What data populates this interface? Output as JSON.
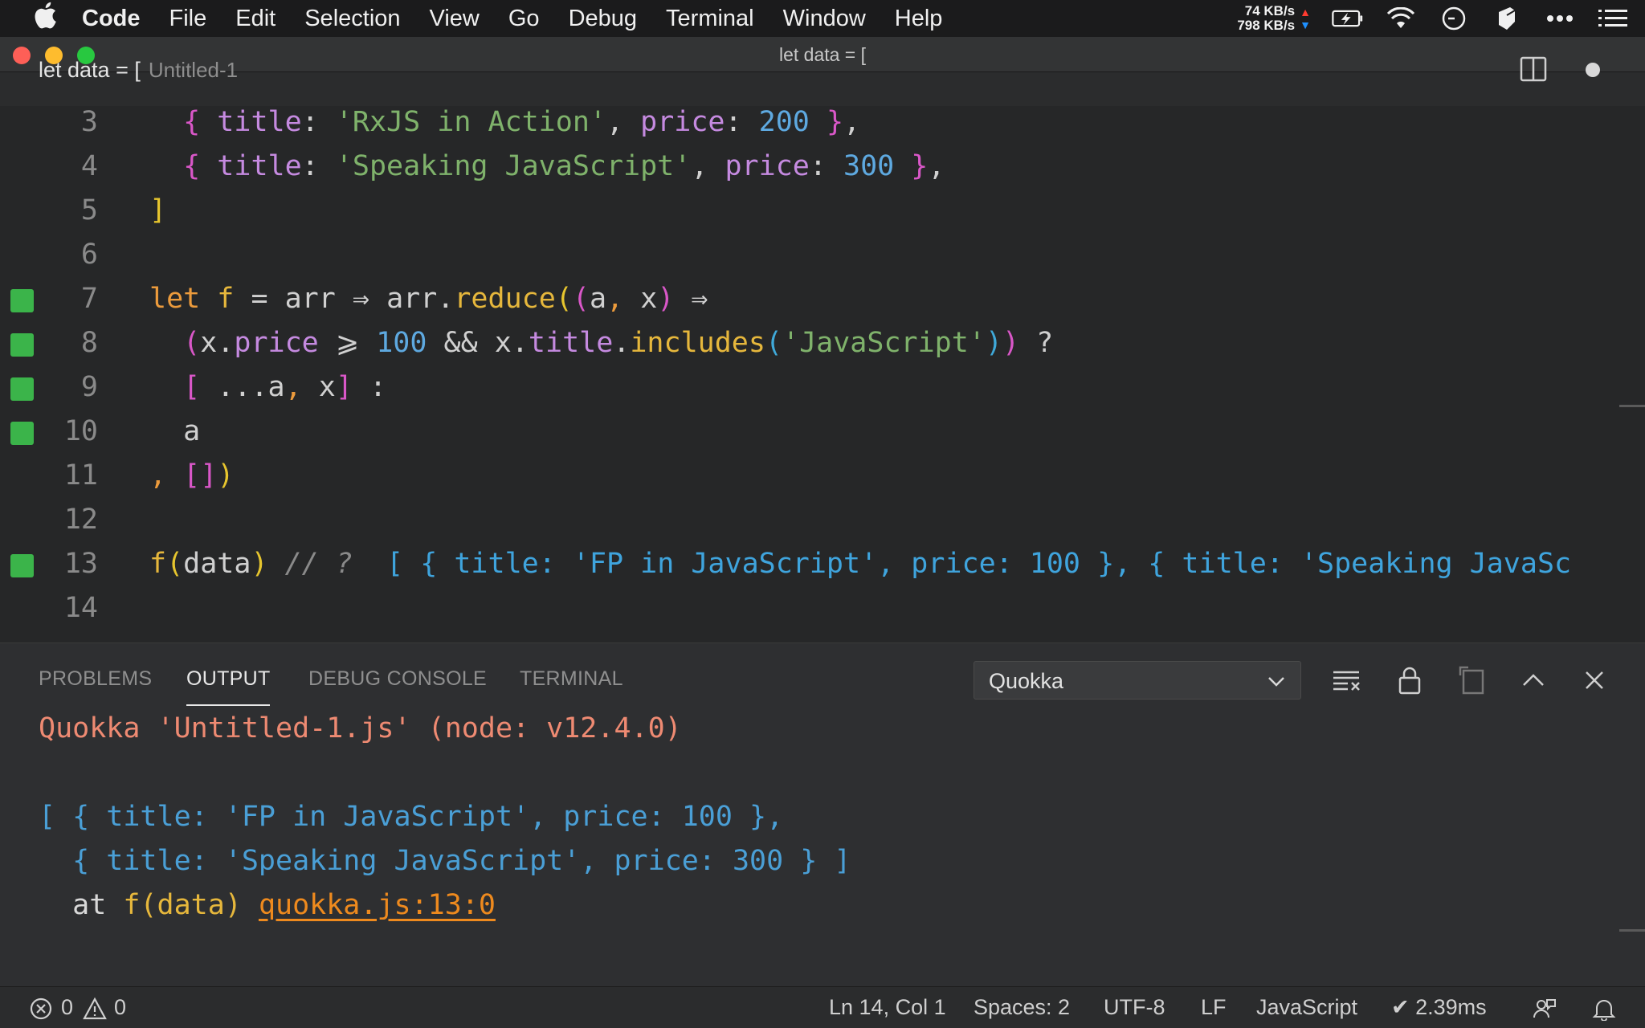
{
  "menubar": {
    "items": [
      "Code",
      "File",
      "Edit",
      "Selection",
      "View",
      "Go",
      "Debug",
      "Terminal",
      "Window",
      "Help"
    ],
    "net_up": "74 KB/s",
    "net_down": "798 KB/s",
    "icons": [
      "battery-charging-icon",
      "wifi-icon",
      "clock-icon",
      "app-icon",
      "more-icon",
      "list-icon"
    ]
  },
  "window": {
    "title": "let data = [",
    "tab_label": "let data = [",
    "tab_description": "Untitled-1"
  },
  "editor": {
    "lines": [
      {
        "n": "3",
        "marked": false
      },
      {
        "n": "4",
        "marked": false
      },
      {
        "n": "5",
        "marked": false
      },
      {
        "n": "6",
        "marked": false
      },
      {
        "n": "7",
        "marked": true
      },
      {
        "n": "8",
        "marked": true
      },
      {
        "n": "9",
        "marked": true
      },
      {
        "n": "10",
        "marked": true
      },
      {
        "n": "11",
        "marked": false
      },
      {
        "n": "12",
        "marked": false
      },
      {
        "n": "13",
        "marked": true
      },
      {
        "n": "14",
        "marked": false
      }
    ],
    "code": {
      "l3_title_key": "title",
      "l3_title": "'RxJS in Action'",
      "l3_price_key": "price",
      "l3_price": "200",
      "l4_title_key": "title",
      "l4_title": "'Speaking JavaScript'",
      "l4_price_key": "price",
      "l4_price": "300",
      "l5": "]",
      "l7_let": "let",
      "l7_f": "f",
      "l7_eq": "=",
      "l7_arr": "arr",
      "l7_arrow": "⇒",
      "l7_arr2": "arr",
      "l7_reduce": "reduce",
      "l7_a": "a",
      "l7_x": "x",
      "l8_x": "x",
      "l8_price": "price",
      "l8_gte": "⩾",
      "l8_100": "100",
      "l8_and": "&&",
      "l8_x2": "x",
      "l8_title": "title",
      "l8_includes": "includes",
      "l8_str": "'JavaScript'",
      "l8_q": "?",
      "l9_spread": "...",
      "l9_a": "a",
      "l9_x": "x",
      "l9_colon": ":",
      "l10_a": "a",
      "l11_comma": ",",
      "l13_f": "f",
      "l13_data": "data",
      "l13_comment": "// ?",
      "l13_inline": "[ { title: 'FP in JavaScript', price: 100 }, { title: 'Speaking JavaSc"
    }
  },
  "panel": {
    "tabs": [
      "PROBLEMS",
      "OUTPUT",
      "DEBUG CONSOLE",
      "TERMINAL"
    ],
    "active_tab": "OUTPUT",
    "output_channel": "Quokka",
    "output": {
      "header": "Quokka 'Untitled-1.js' (node: v12.4.0)",
      "line1": "[ { title: 'FP in JavaScript', price: 100 },",
      "line2": "  { title: 'Speaking JavaScript', price: 300 } ]",
      "at": "  at ",
      "at_expr": "f(data)",
      "link": "quokka.js:13:0"
    }
  },
  "statusbar": {
    "errors": "0",
    "warnings": "0",
    "cursor": "Ln 14, Col 1",
    "spaces": "Spaces: 2",
    "encoding": "UTF-8",
    "eol": "LF",
    "language": "JavaScript",
    "timing": "✔ 2.39ms"
  },
  "colors": {
    "accent_green": "#3bb44a",
    "keyword": "#ec9b3c",
    "property": "#c58ae0",
    "string": "#7fb26b",
    "number": "#5ea9e0",
    "quokka_header": "#ee8a72",
    "link": "#ee8a1e"
  }
}
